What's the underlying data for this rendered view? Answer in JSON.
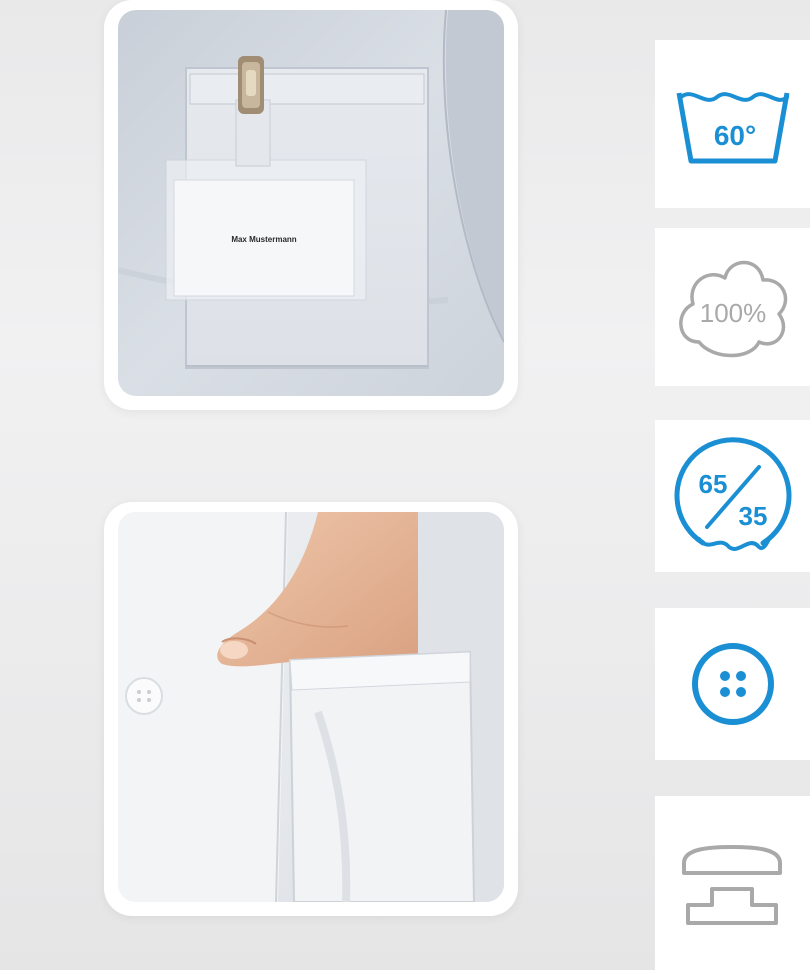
{
  "photos": {
    "top": {
      "subject": "lab-coat-chest-pocket",
      "badge_text": "Max Mustermann"
    },
    "bottom": {
      "subject": "lab-coat-side-pocket-hand"
    }
  },
  "icons": [
    {
      "name": "wash-60-icon",
      "text": "60°",
      "color": "#1a8fd4"
    },
    {
      "name": "cotton-100-icon",
      "text": "100%",
      "color": "#a9a9a9"
    },
    {
      "name": "blend-65-35-icon",
      "top": "65",
      "bottom": "35",
      "color": "#1a8fd4"
    },
    {
      "name": "button-icon",
      "color": "#1a8fd4"
    },
    {
      "name": "press-stud-icon",
      "color": "#a9a9a9"
    }
  ]
}
